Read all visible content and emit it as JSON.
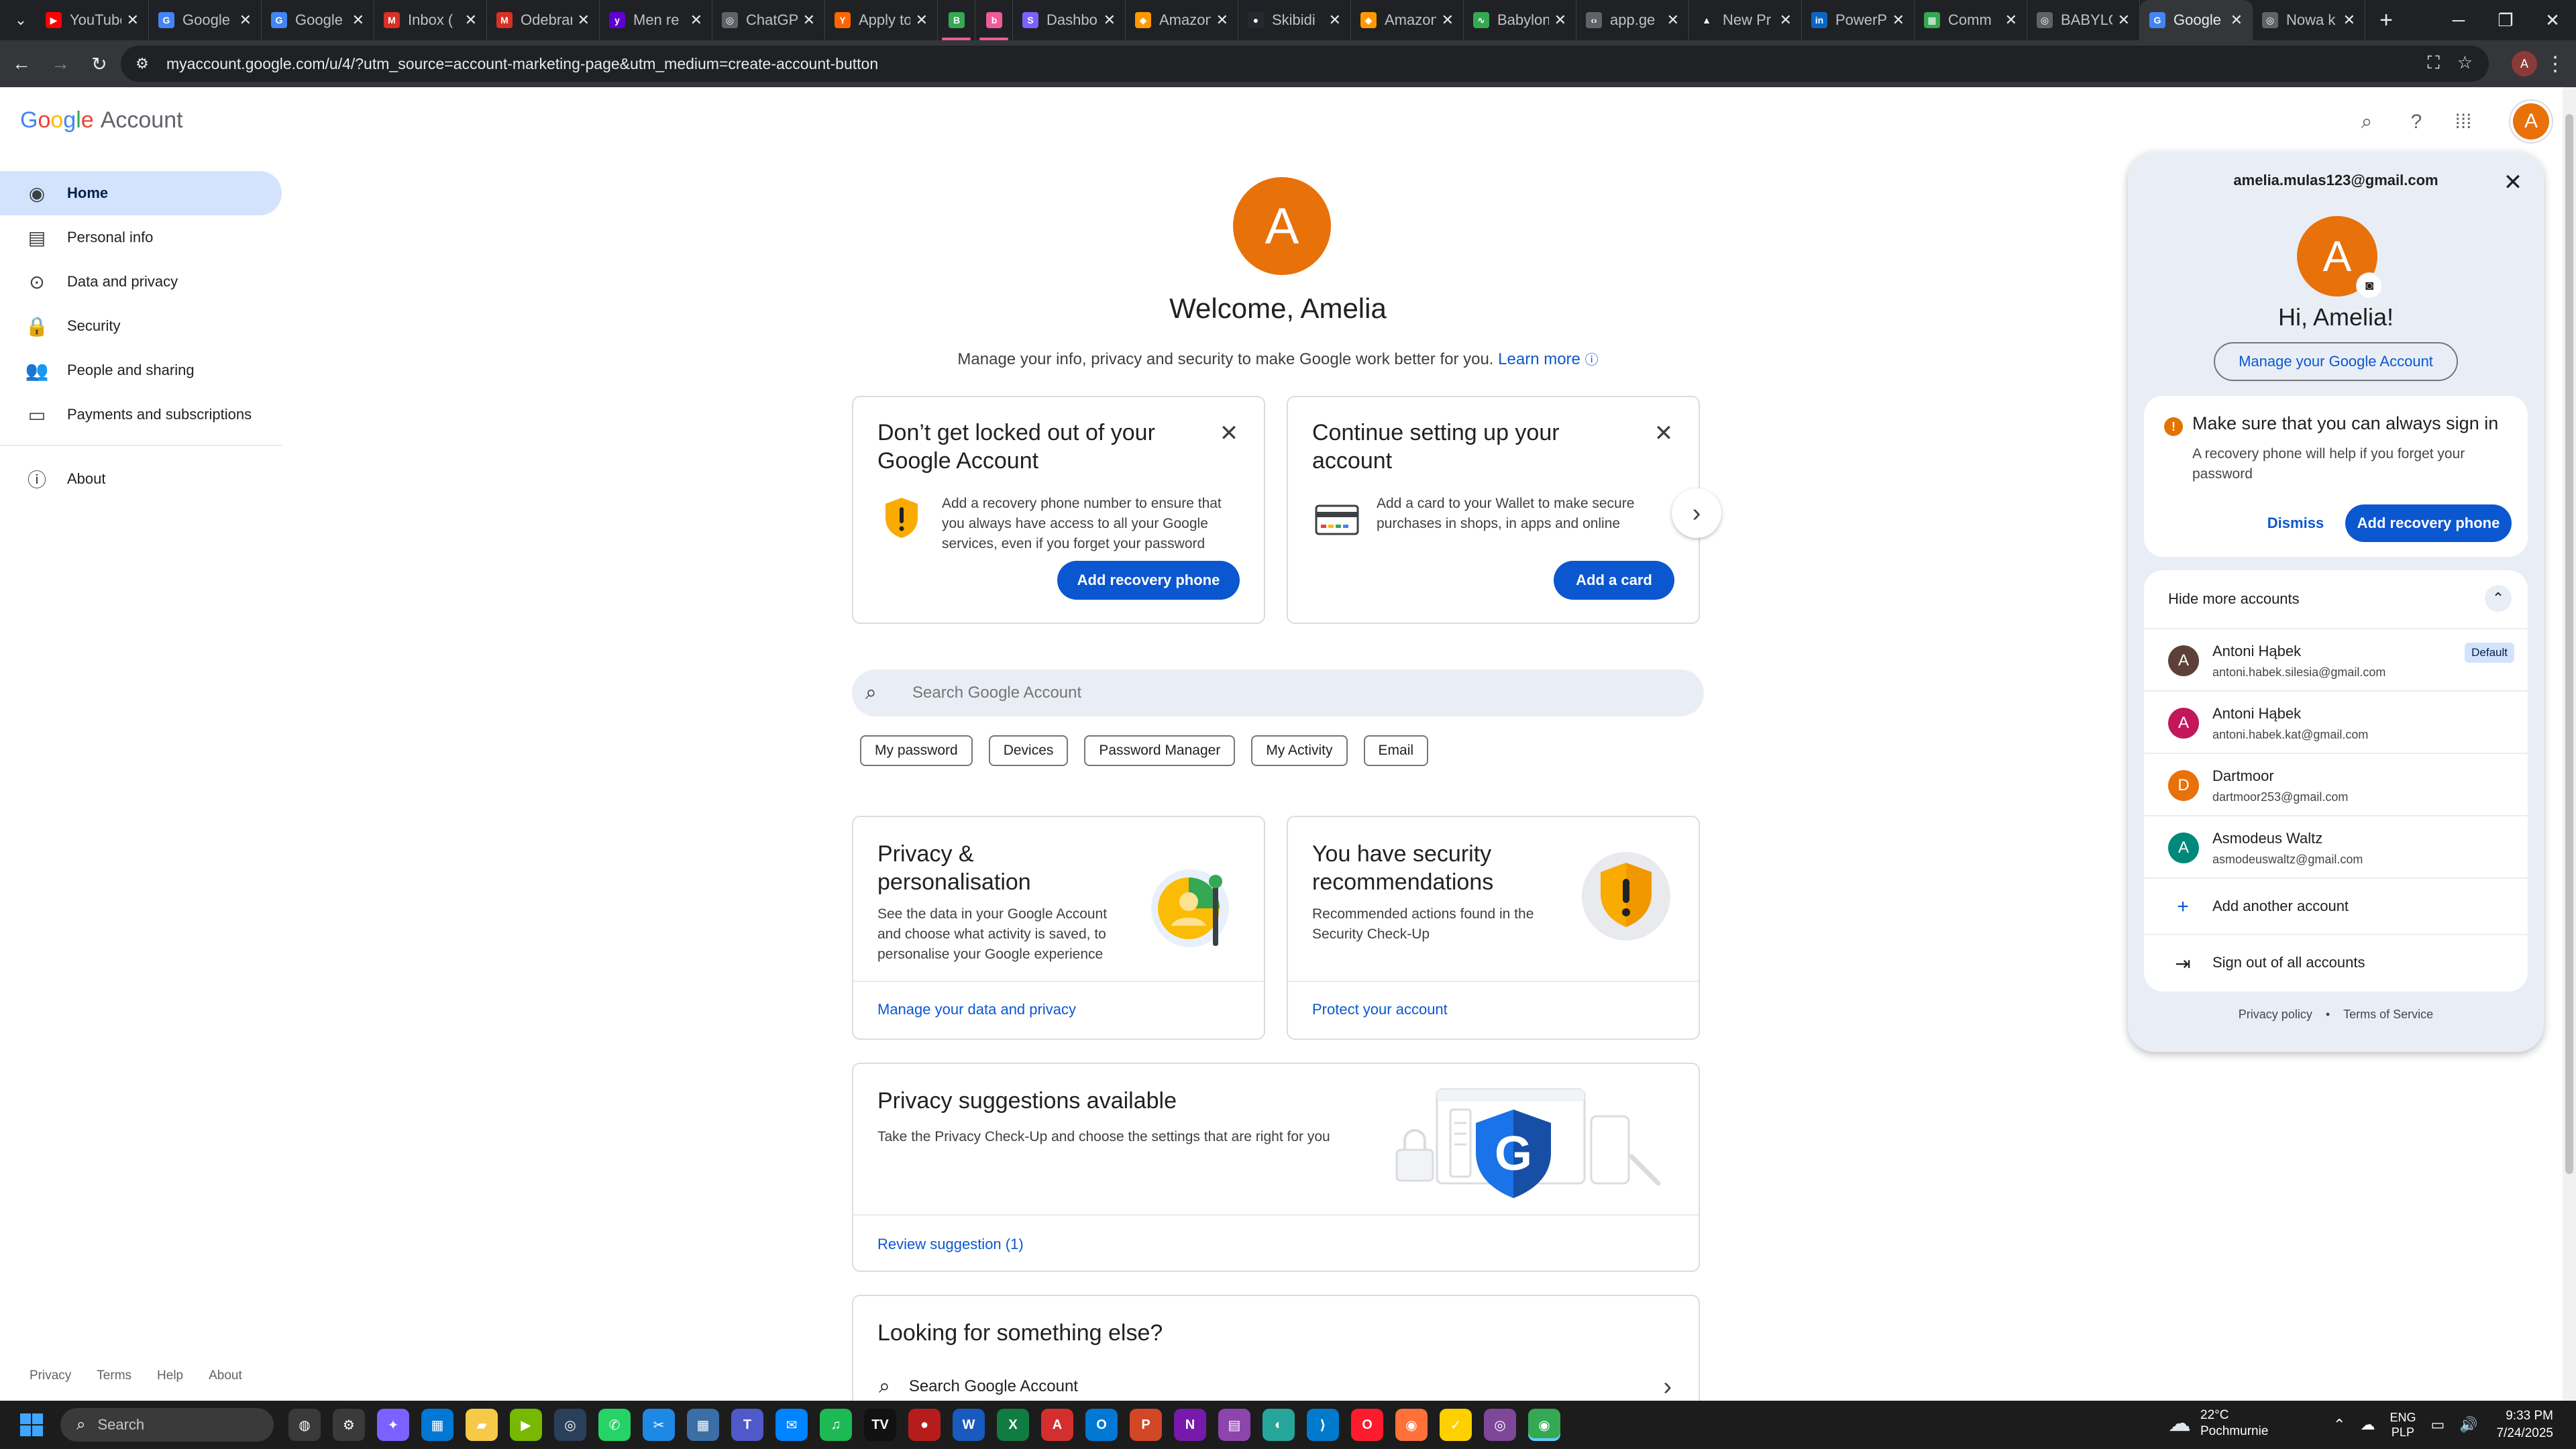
{
  "browser": {
    "tabs": [
      {
        "title": "YouTube",
        "fav": "▶",
        "color": "#ff0000"
      },
      {
        "title": "Google Docs",
        "fav": "G",
        "color": "#4285f4"
      },
      {
        "title": "Google",
        "fav": "G",
        "color": "#4285f4"
      },
      {
        "title": "Inbox (",
        "fav": "M",
        "color": "#d93025"
      },
      {
        "title": "Odebrane",
        "fav": "M",
        "color": "#d93025"
      },
      {
        "title": "Men re",
        "fav": "y",
        "color": "#6001d2"
      },
      {
        "title": "ChatGPT",
        "fav": "◎",
        "color": "#5f6368"
      },
      {
        "title": "Apply to",
        "fav": "Y",
        "color": "#ff6600"
      },
      {
        "title": "",
        "fav": "B",
        "color": "#34a853"
      },
      {
        "title": "",
        "fav": "b",
        "color": "#ee5b9b"
      },
      {
        "title": "Dashboard",
        "fav": "S",
        "color": "#7b61ff"
      },
      {
        "title": "Amazon",
        "fav": "◆",
        "color": "#ff9900"
      },
      {
        "title": "Skibidi",
        "fav": "●",
        "color": "#24292f"
      },
      {
        "title": "Amazon",
        "fav": "◆",
        "color": "#ff9900"
      },
      {
        "title": "Babylon",
        "fav": "∿",
        "color": "#34a853"
      },
      {
        "title": "app.ge",
        "fav": "‹›",
        "color": "#5f6368"
      },
      {
        "title": "New Pr",
        "fav": "▲",
        "color": "#202124"
      },
      {
        "title": "PowerPoint",
        "fav": "in",
        "color": "#0a66c2"
      },
      {
        "title": "Comm",
        "fav": "▦",
        "color": "#34a853"
      },
      {
        "title": "BABYLON",
        "fav": "◎",
        "color": "#5f6368"
      },
      {
        "title": "Google",
        "fav": "G",
        "color": "#4285f4",
        "active": true
      },
      {
        "title": "Nowa k",
        "fav": "◎",
        "color": "#5f6368"
      }
    ],
    "new_tab": "+",
    "url": "myaccount.google.com/u/4/?utm_source=account-marketing-page&utm_medium=create-account-button",
    "profile_initial": "A"
  },
  "header": {
    "logo_letters": [
      "G",
      "o",
      "o",
      "g",
      "l",
      "e"
    ],
    "logo_suffix": "Account",
    "avatar_initial": "A"
  },
  "sidebar": {
    "items": [
      {
        "label": "Home",
        "icon": "person-circle-icon",
        "glyph": "◉",
        "selected": true
      },
      {
        "label": "Personal info",
        "icon": "id-card-icon",
        "glyph": "▤"
      },
      {
        "label": "Data and privacy",
        "icon": "toggle-icon",
        "glyph": "⊙"
      },
      {
        "label": "Security",
        "icon": "lock-icon",
        "glyph": "🔒"
      },
      {
        "label": "People and sharing",
        "icon": "people-icon",
        "glyph": "👥"
      },
      {
        "label": "Payments and subscriptions",
        "icon": "credit-card-icon",
        "glyph": "▭"
      }
    ],
    "about": {
      "label": "About",
      "icon": "info-icon",
      "glyph": "ⓘ"
    },
    "footer_links": [
      "Privacy",
      "Terms",
      "Help",
      "About"
    ]
  },
  "main": {
    "avatar_initial": "A",
    "welcome": "Welcome, Amelia",
    "subtitle": "Manage your info, privacy and security to make Google work better for you.",
    "learn_more": "Learn more",
    "card_locked": {
      "title": "Don’t get locked out of your Google Account",
      "body": "Add a recovery phone number to ensure that you always have access to all your Google services, even if you forget your password",
      "button": "Add recovery phone"
    },
    "card_setup": {
      "title": "Continue setting up your account",
      "body": "Add a card to your Wallet to make secure purchases in shops, in apps and online",
      "button": "Add a card"
    },
    "search_placeholder": "Search Google Account",
    "chips": [
      "My password",
      "Devices",
      "Password Manager",
      "My Activity",
      "Email"
    ],
    "privacy_card": {
      "title": "Privacy & personalisation",
      "body": "See the data in your Google Account and choose what activity is saved, to personalise your Google experience",
      "link": "Manage your data and privacy"
    },
    "security_card": {
      "title": "You have security recommendations",
      "body": "Recommended actions found in the Security Check-Up",
      "link": "Protect your account"
    },
    "suggestions_card": {
      "title": "Privacy suggestions available",
      "body": "Take the Privacy Check-Up and choose the settings that are right for you",
      "link": "Review suggestion (1)"
    },
    "looking_card": {
      "title": "Looking for something else?",
      "search_row": "Search Google Account"
    }
  },
  "popup": {
    "email": "amelia.mulas123@gmail.com",
    "avatar_initial": "A",
    "greeting": "Hi, Amelia!",
    "manage_button": "Manage your Google Account",
    "warning": {
      "title": "Make sure that you can always sign in",
      "body": "A recovery phone will help if you forget your password",
      "dismiss": "Dismiss",
      "action": "Add recovery phone"
    },
    "hide_accounts": "Hide more accounts",
    "accounts": [
      {
        "name": "Antoni Hąbek",
        "email": "antoni.habek.silesia@gmail.com",
        "initial": "A",
        "color": "#5d4037",
        "badge": "Default"
      },
      {
        "name": "Antoni Hąbek",
        "email": "antoni.habek.kat@gmail.com",
        "initial": "A",
        "color": "#c2185b"
      },
      {
        "name": "Dartmoor",
        "email": "dartmoor253@gmail.com",
        "initial": "D",
        "color": "#e8710a"
      },
      {
        "name": "Asmodeus Waltz",
        "email": "asmodeuswaltz@gmail.com",
        "initial": "A",
        "color": "#00897b"
      }
    ],
    "add_account": "Add another account",
    "sign_out": "Sign out of all accounts",
    "footer": {
      "privacy": "Privacy policy",
      "dot": "•",
      "terms": "Terms of Service"
    }
  },
  "taskbar": {
    "search": "Search",
    "weather_temp": "22°C",
    "weather_place": "Pochmurnie",
    "lang_top": "ENG",
    "lang_bottom": "PLP",
    "time": "9:33 PM",
    "date": "7/24/2025",
    "apps": [
      {
        "name": "copilot-app",
        "glyph": "◍",
        "color": "#3a3a3a"
      },
      {
        "name": "settings-app",
        "glyph": "⚙",
        "color": "#3a3a3a"
      },
      {
        "name": "copilot-colors-app",
        "glyph": "✦",
        "color": "#7b61ff"
      },
      {
        "name": "store-app",
        "glyph": "▦",
        "color": "#0078d4"
      },
      {
        "name": "explorer-app",
        "glyph": "▰",
        "color": "#f7c948"
      },
      {
        "name": "nvidia-app",
        "glyph": "▶",
        "color": "#76b900"
      },
      {
        "name": "steam-app",
        "glyph": "◎",
        "color": "#2a3f5a"
      },
      {
        "name": "whatsapp-app",
        "glyph": "✆",
        "color": "#25d366"
      },
      {
        "name": "snip-app",
        "glyph": "✂",
        "color": "#1e88e5"
      },
      {
        "name": "calculator-app",
        "glyph": "▦",
        "color": "#3a6ea5"
      },
      {
        "name": "teams-app",
        "glyph": "T",
        "color": "#5059c9"
      },
      {
        "name": "messenger-app",
        "glyph": "✉",
        "color": "#0084ff"
      },
      {
        "name": "spotify-app",
        "glyph": "♫",
        "color": "#1db954"
      },
      {
        "name": "tidal-app",
        "glyph": "TV",
        "color": "#111111"
      },
      {
        "name": "record-app",
        "glyph": "●",
        "color": "#b71c1c"
      },
      {
        "name": "word-app",
        "glyph": "W",
        "color": "#185abd"
      },
      {
        "name": "excel-app",
        "glyph": "X",
        "color": "#107c41"
      },
      {
        "name": "acrobat-app",
        "glyph": "A",
        "color": "#d32f2f"
      },
      {
        "name": "outlook-app",
        "glyph": "O",
        "color": "#0078d4"
      },
      {
        "name": "powerpoint-app",
        "glyph": "P",
        "color": "#d24726"
      },
      {
        "name": "onenote-app",
        "glyph": "N",
        "color": "#7719aa"
      },
      {
        "name": "files-app",
        "glyph": "▤",
        "color": "#8e44ad"
      },
      {
        "name": "web-app",
        "glyph": "◐",
        "color": "#26a69a"
      },
      {
        "name": "vscode-app",
        "glyph": "⟩",
        "color": "#007acc"
      },
      {
        "name": "opera-app",
        "glyph": "O",
        "color": "#ff1b2d"
      },
      {
        "name": "firefox-app",
        "glyph": "◉",
        "color": "#ff7139"
      },
      {
        "name": "norton-app",
        "glyph": "✓",
        "color": "#ffd000"
      },
      {
        "name": "tor-app",
        "glyph": "◎",
        "color": "#7e4798"
      },
      {
        "name": "chrome-app",
        "glyph": "◉",
        "color": "#34a853",
        "active": true
      }
    ]
  }
}
